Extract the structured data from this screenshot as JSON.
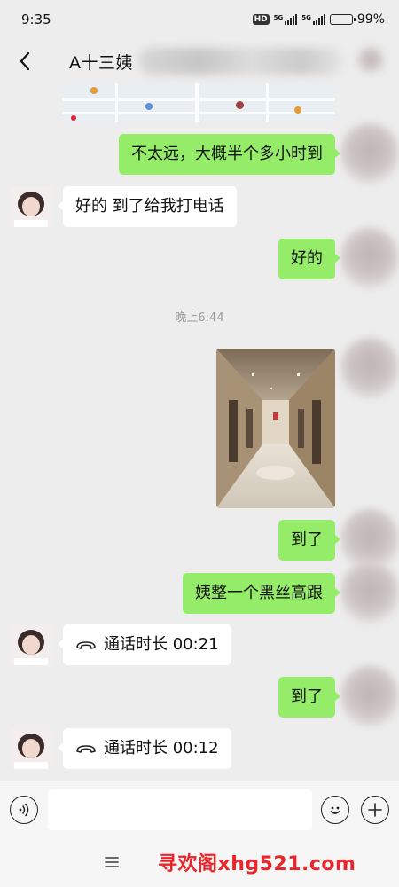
{
  "status_bar": {
    "time": "9:35",
    "hd_label": "HD",
    "network_1": "5G",
    "network_2": "5G",
    "battery_percent": 99,
    "battery_label": "99%"
  },
  "header": {
    "title": "A十三姨"
  },
  "messages": {
    "m1_text": "不太远，大概半个多小时到",
    "m2_text": "好的 到了给我打电话",
    "m3_text": "好的",
    "timestamp": "晚上6:44",
    "m5_text": "到了",
    "m6_text": "姨整一个黑丝高跟",
    "call1_text": "通话时长 00:21",
    "m8_text": "到了",
    "call2_text": "通话时长 00:12"
  },
  "input_bar": {
    "value": "",
    "placeholder": ""
  },
  "watermark": {
    "text": "寻欢阁xhg521.com",
    "color": "#e8262b"
  },
  "colors": {
    "outgoing_bubble": "#95ec69",
    "incoming_bubble": "#ffffff",
    "background": "#ededed"
  },
  "icons": {
    "back": "chevron-left-icon",
    "voice": "voice-input-icon",
    "emoji": "emoji-icon",
    "plus": "plus-icon",
    "call": "phone-call-icon",
    "nav_menu": "menu-icon"
  }
}
